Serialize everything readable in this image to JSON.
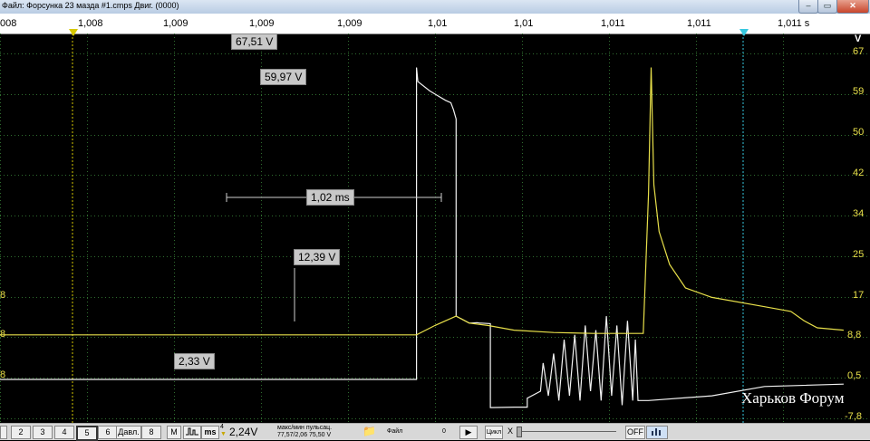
{
  "window": {
    "title": "Файл: Форсунка 23 мазда #1.cmps   Двиг. (0000)",
    "min": "–",
    "max": "▭",
    "close": "✕"
  },
  "ruler": {
    "ticks": [
      "008",
      "1,008",
      "1,009",
      "1,009",
      "1,009",
      "1,01",
      "1,01",
      "1,011",
      "1,011",
      "1,011 s"
    ]
  },
  "axis_right": {
    "unit": "V",
    "labels": [
      "67",
      "59",
      "50",
      "42",
      "34",
      "25",
      "17",
      "8,8",
      "0,5",
      "-7,8"
    ]
  },
  "axis_left": {
    "labels": [
      "8",
      "8",
      "8"
    ]
  },
  "annotations": {
    "peak": "67,51 V",
    "plateau": "59,97 V",
    "duration": "1,02 ms",
    "hold": "12,39 V",
    "base": "2,33 V"
  },
  "watermark": "Харьков Форум",
  "toolbar": {
    "buttons": [
      "2",
      "3",
      "4",
      "5",
      "6"
    ],
    "pressure": "Давл.",
    "pressure_num": "8",
    "m_label": "M",
    "ms_label": "ms",
    "channel_num": "4",
    "channel_value": "2,24V",
    "stats_title": "макс/мин  пульсац.",
    "stats_values": "77,57/2,06  75,50 V",
    "file_label": "Файл",
    "file_count": "0",
    "play": "▶",
    "cycle": "Цикл",
    "x_label": "X",
    "off_label": "OFF"
  },
  "colors": {
    "trace_white": "#f2f2f2",
    "trace_yellow": "#e8e04a",
    "grid": "#2f6d2f",
    "cursor_yellow": "#d6c800",
    "cursor_cyan": "#36c8e0"
  },
  "chart_data": {
    "type": "line",
    "xlim": [
      1.0079,
      1.0112
    ],
    "ylim": [
      -7.8,
      70
    ],
    "series": [
      {
        "color": "white",
        "x": [
          1.0079,
          1.00948,
          1.00948,
          1.009485,
          1.00953,
          1.00956,
          1.00959,
          1.00961,
          1.00962,
          1.00963,
          1.00963,
          1.00968,
          1.00971,
          1.00972,
          1.009725,
          1.00976,
          1.00976,
          1.00985,
          1.0099,
          1.0099,
          1.00995,
          1.00996,
          1.00998,
          1.01,
          1.01002,
          1.01004,
          1.01006,
          1.01008,
          1.0101,
          1.01012,
          1.01014,
          1.01016,
          1.01018,
          1.0102,
          1.01022,
          1.01024,
          1.01026,
          1.01028,
          1.0103,
          1.01031,
          1.01032,
          1.01036,
          1.0106,
          1.0108,
          1.0111
        ],
        "y": [
          0.5,
          0.5,
          67,
          64,
          62,
          61,
          60,
          59.5,
          58,
          56,
          14,
          12.5,
          12.6,
          12.5,
          12.5,
          12.4,
          -5.5,
          -5.4,
          -5.4,
          -3.5,
          -2,
          4,
          -3,
          6,
          -4,
          9,
          -3,
          10,
          -4,
          12,
          -2,
          11,
          -4,
          14,
          -3,
          12,
          -5,
          13,
          -4,
          9,
          -4,
          -4,
          -3,
          -1,
          -0.5
        ]
      },
      {
        "color": "yellow",
        "x": [
          1.0079,
          1.00948,
          1.00955,
          1.00963,
          1.00968,
          1.00975,
          1.00985,
          1.01,
          1.01015,
          1.01034,
          1.01036,
          1.01037,
          1.01038,
          1.0104,
          1.01044,
          1.0105,
          1.0106,
          1.0108,
          1.0109,
          1.01095,
          1.011,
          1.0111
        ],
        "y": [
          10,
          10,
          12,
          14,
          12.5,
          12,
          11,
          10.5,
          10.3,
          10.3,
          40,
          67,
          42,
          32,
          25,
          20,
          18,
          16,
          15,
          13,
          11.5,
          11
        ]
      }
    ]
  }
}
